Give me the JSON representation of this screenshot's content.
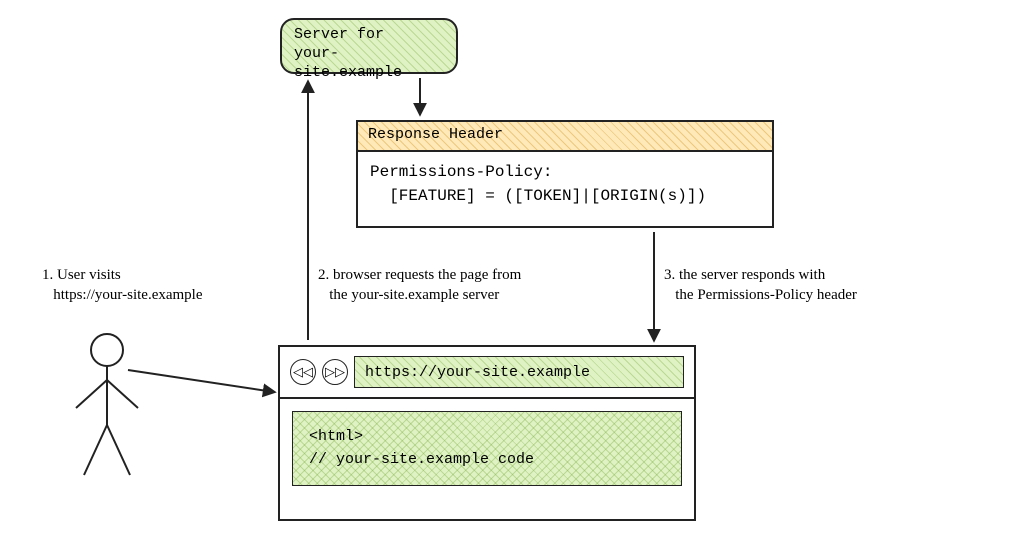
{
  "server": {
    "line1": "Server for",
    "line2": "your-site.example"
  },
  "response_header": {
    "title": "Response Header",
    "policy_line1": "Permissions-Policy:",
    "policy_line2": "  [FEATURE] = ([TOKEN]|[ORIGIN(s)])"
  },
  "captions": {
    "step1_line1": "1. User visits",
    "step1_line2": "   https://your-site.example",
    "step2_line1": "2. browser requests the page from",
    "step2_line2": "   the your-site.example server",
    "step3_line1": "3. the server responds with",
    "step3_line2": "   the Permissions-Policy header"
  },
  "browser": {
    "back_icon": "◁◁",
    "forward_icon": "▷▷",
    "address": "https://your-site.example",
    "code_line1": "<html>",
    "code_line2": "// your-site.example code"
  }
}
